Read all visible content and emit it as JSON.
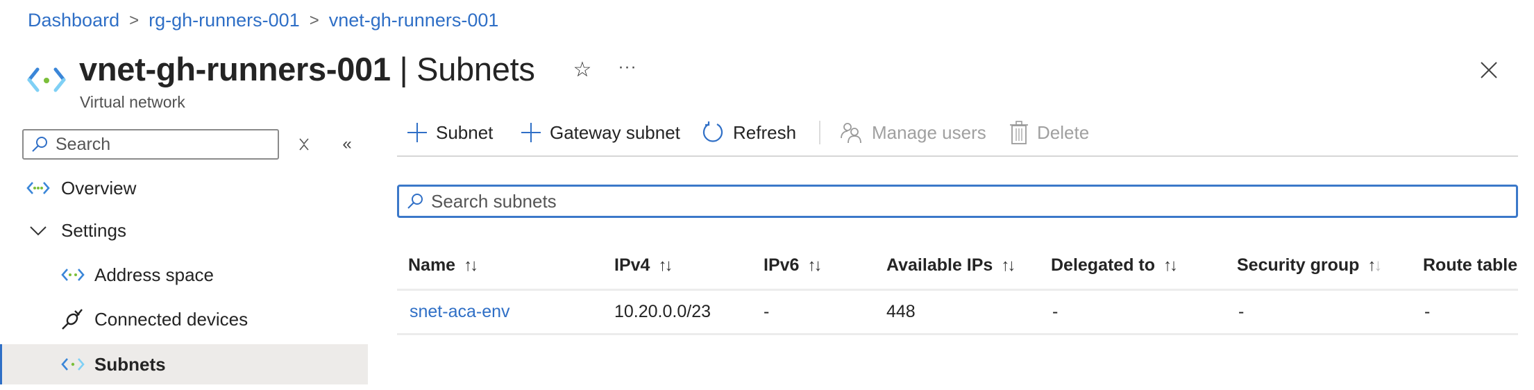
{
  "breadcrumb": {
    "items": [
      "Dashboard",
      "rg-gh-runners-001",
      "vnet-gh-runners-001"
    ],
    "separator": ">"
  },
  "header": {
    "resource_name": "vnet-gh-runners-001",
    "divider": "|",
    "blade_name": "Subnets",
    "subtitle": "Virtual network",
    "favorite_icon": "star-icon",
    "more_icon": "ellipsis-icon",
    "more_label": "···",
    "close_icon": "close-icon"
  },
  "sidebar": {
    "search_placeholder": "Search",
    "collapse_label": "«",
    "items": [
      {
        "label": "Overview",
        "icon": "vnet-icon",
        "level": 0,
        "selected": false
      },
      {
        "label": "Settings",
        "icon": "chevron-down-icon",
        "level": 0,
        "selected": false,
        "expanded": true
      },
      {
        "label": "Address space",
        "icon": "vnet-icon",
        "level": 1,
        "selected": false
      },
      {
        "label": "Connected devices",
        "icon": "plug-icon",
        "level": 1,
        "selected": false
      },
      {
        "label": "Subnets",
        "icon": "vnet-icon",
        "level": 1,
        "selected": true
      }
    ]
  },
  "toolbar": {
    "add_subnet": "Subnet",
    "add_gateway_subnet": "Gateway subnet",
    "refresh": "Refresh",
    "manage_users": "Manage users",
    "delete": "Delete"
  },
  "subnet_search": {
    "placeholder": "Search subnets",
    "value": ""
  },
  "table": {
    "columns": [
      {
        "label": "Name",
        "sortable": true
      },
      {
        "label": "IPv4",
        "sortable": true
      },
      {
        "label": "IPv6",
        "sortable": true
      },
      {
        "label": "Available IPs",
        "sortable": true
      },
      {
        "label": "Delegated to",
        "sortable": true
      },
      {
        "label": "Security group",
        "sortable": true,
        "sort_state": "ascending"
      },
      {
        "label": "Route table",
        "sortable": false
      }
    ],
    "sort_glyph_up": "↑",
    "sort_glyph_down": "↓",
    "rows": [
      [
        "snet-aca-env",
        "10.20.0.0/23",
        "-",
        "448",
        "-",
        "-",
        "-"
      ]
    ]
  },
  "colors": {
    "accent": "#2f6fc6",
    "selected_nav_bg": "#edebe9",
    "disabled_text": "#a0a0a0",
    "focus_border": "#3b78c9"
  }
}
